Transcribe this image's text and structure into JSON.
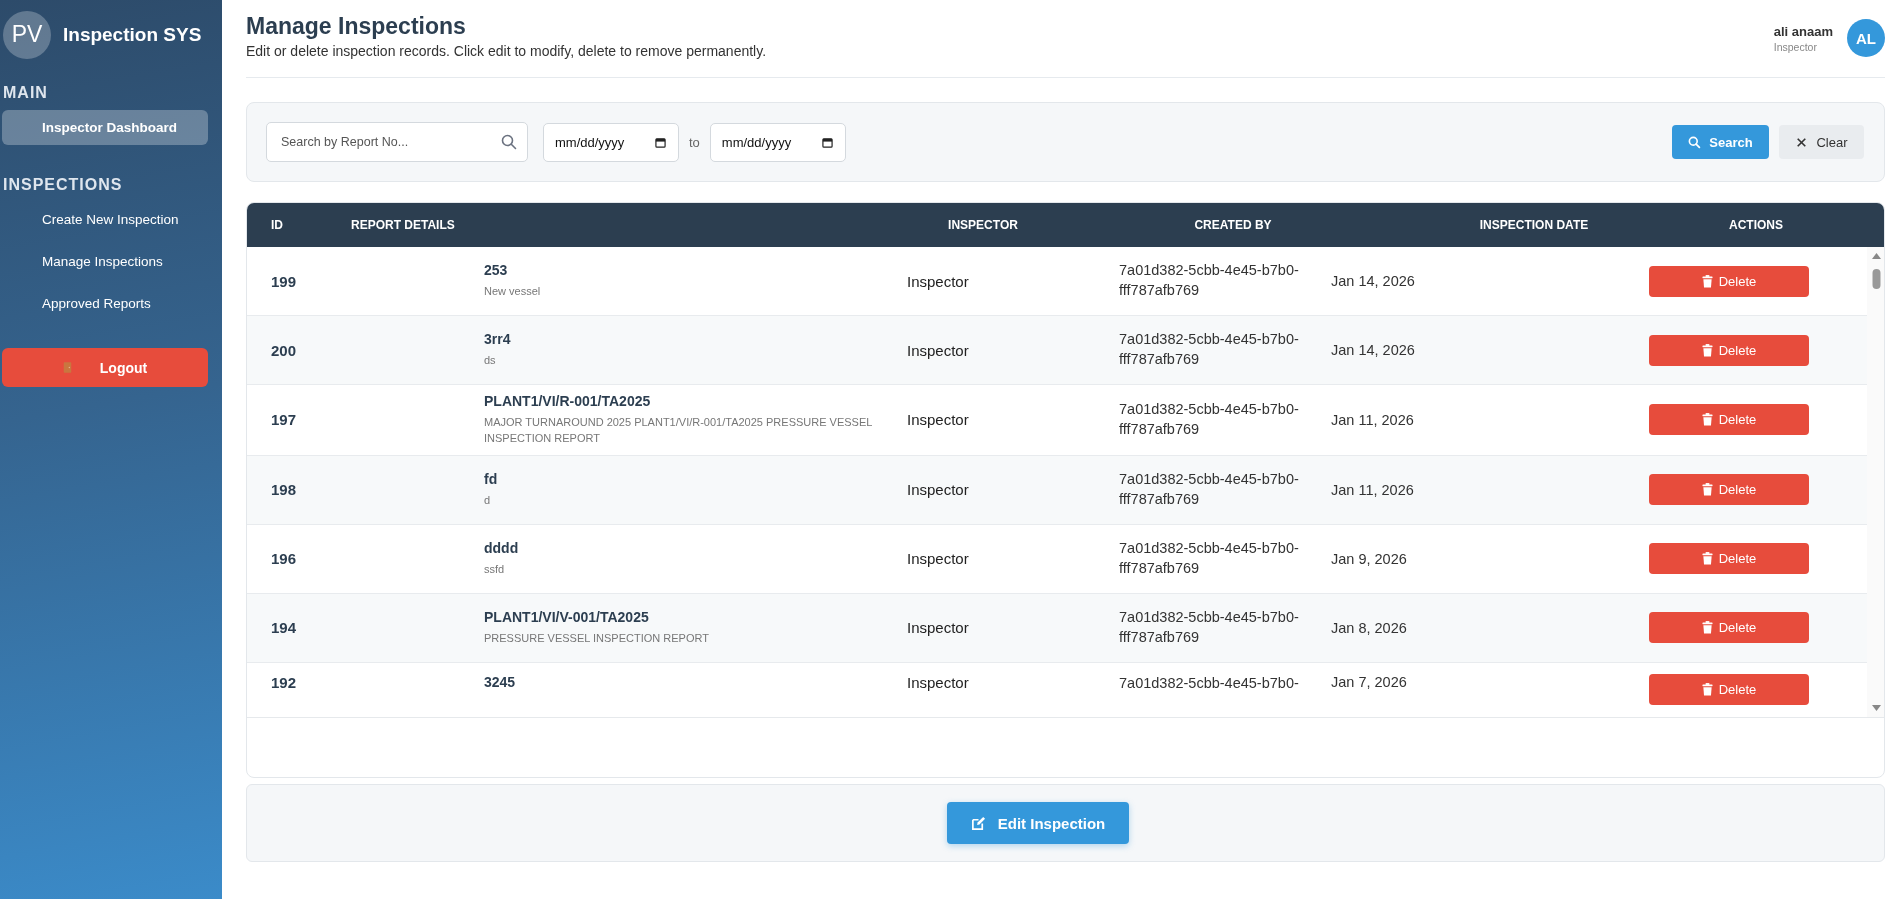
{
  "sidebar": {
    "logo": "PV",
    "brand": "Inspection SYS",
    "sections": [
      {
        "title": "MAIN",
        "items": [
          {
            "label": "Inspector Dashboard",
            "selected": true
          }
        ]
      },
      {
        "title": "INSPECTIONS",
        "items": [
          {
            "label": "Create New Inspection",
            "selected": false
          },
          {
            "label": "Manage Inspections",
            "selected": false
          },
          {
            "label": "Approved Reports",
            "selected": false
          }
        ]
      }
    ],
    "logout": "Logout"
  },
  "header": {
    "title": "Manage Inspections",
    "subtitle": "Edit or delete inspection records. Click edit to modify, delete to remove permanently.",
    "user": {
      "name": "ali anaam",
      "role": "Inspector",
      "initials": "AL"
    }
  },
  "filters": {
    "search": {
      "placeholder": "Search by Report No..."
    },
    "date_from": "mm/dd/yyyy",
    "to": "to",
    "date_to": "mm/dd/yyyy",
    "search_button": "Search",
    "clear_button": "Clear"
  },
  "table": {
    "columns": [
      "ID",
      "REPORT DETAILS",
      "INSPECTOR",
      "CREATED BY",
      "INSPECTION DATE",
      "ACTIONS"
    ],
    "rows": [
      {
        "id": "199",
        "report": "253",
        "description": "New vessel",
        "inspector": "Inspector",
        "created_by": "7a01d382-5cbb-4e45-b7b0-fff787afb769",
        "date": "Jan 14, 2026",
        "action": "Delete"
      },
      {
        "id": "200",
        "report": "3rr4",
        "description": "ds",
        "inspector": "Inspector",
        "created_by": "7a01d382-5cbb-4e45-b7b0-fff787afb769",
        "date": "Jan 14, 2026",
        "action": "Delete"
      },
      {
        "id": "197",
        "report": "PLANT1/VI/R-001/TA2025",
        "description": "MAJOR TURNAROUND 2025 PLANT1/VI/R-001/TA2025 PRESSURE VESSEL INSPECTION REPORT",
        "inspector": "Inspector",
        "created_by": "7a01d382-5cbb-4e45-b7b0-fff787afb769",
        "date": "Jan 11, 2026",
        "action": "Delete"
      },
      {
        "id": "198",
        "report": "fd",
        "description": "d",
        "inspector": "Inspector",
        "created_by": "7a01d382-5cbb-4e45-b7b0-fff787afb769",
        "date": "Jan 11, 2026",
        "action": "Delete"
      },
      {
        "id": "196",
        "report": "dddd",
        "description": "ssfd",
        "inspector": "Inspector",
        "created_by": "7a01d382-5cbb-4e45-b7b0-fff787afb769",
        "date": "Jan 9, 2026",
        "action": "Delete"
      },
      {
        "id": "194",
        "report": "PLANT1/VI/V-001/TA2025",
        "description": "PRESSURE VESSEL INSPECTION REPORT",
        "inspector": "Inspector",
        "created_by": "7a01d382-5cbb-4e45-b7b0-fff787afb769",
        "date": "Jan 8, 2026",
        "action": "Delete"
      },
      {
        "id": "192",
        "report": "3245",
        "inspector": "Inspector",
        "created_by": "7a01d382-5cbb-4e45-b7b0-",
        "date": "Jan 7, 2026",
        "action": "Delete"
      }
    ]
  },
  "footer": {
    "edit_button": "Edit Inspection"
  }
}
